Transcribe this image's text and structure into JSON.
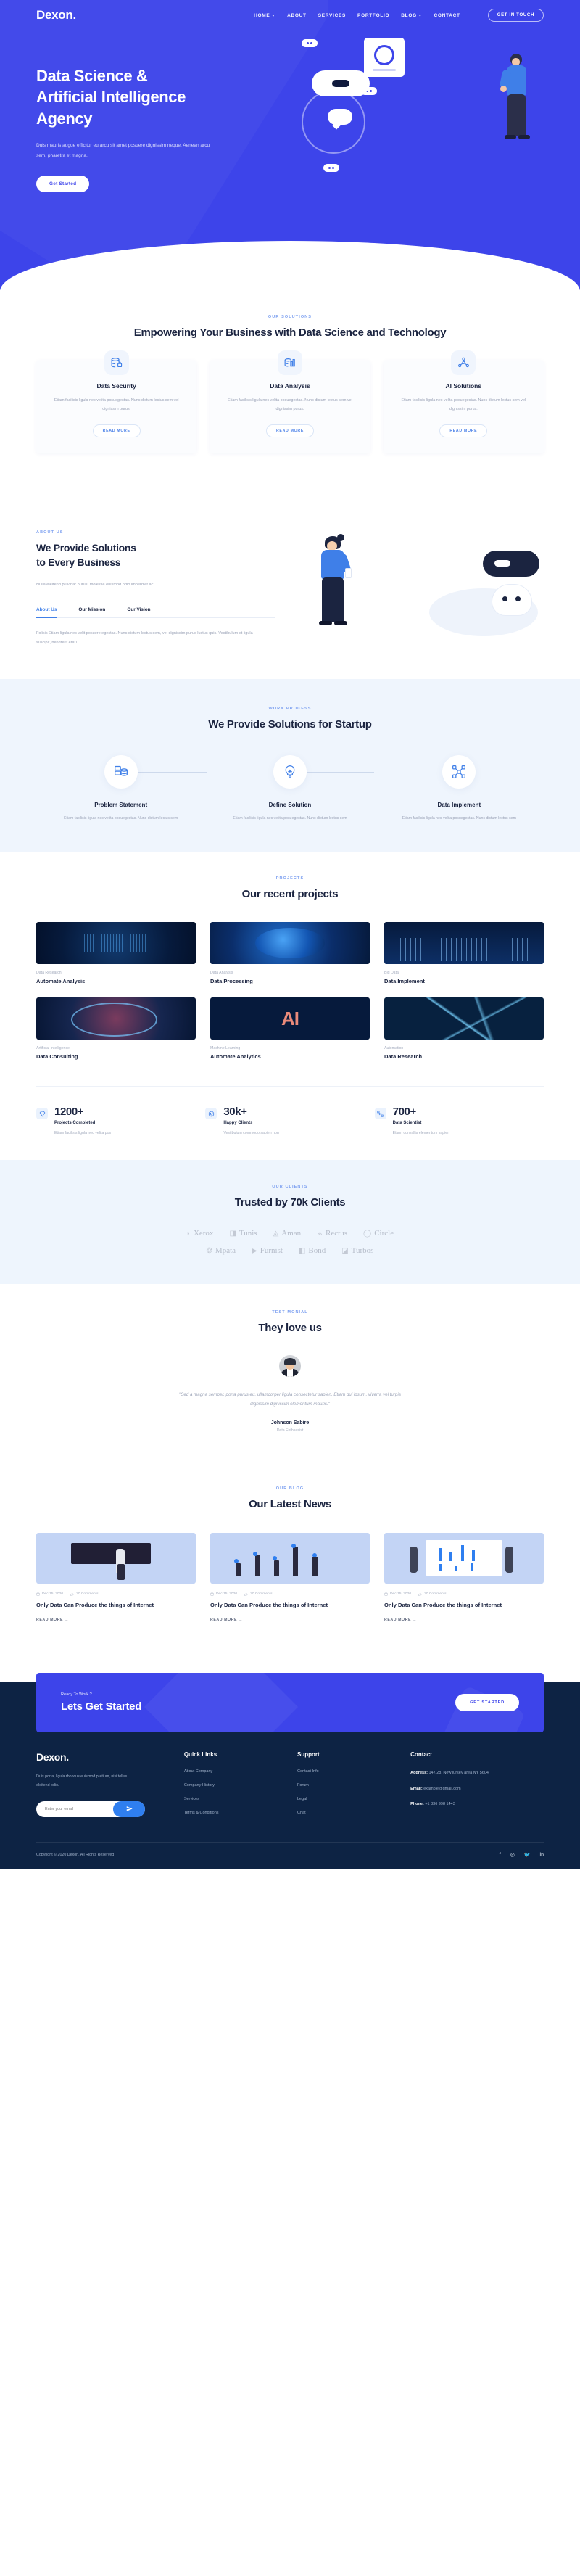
{
  "brand": {
    "name": "Dexon.",
    "accent": "#3d44ea",
    "dark": "#0d2344",
    "link_blue": "#2f7ff0"
  },
  "nav": {
    "items": [
      {
        "label": "HOME",
        "has_caret": true
      },
      {
        "label": "ABOUT",
        "has_caret": false
      },
      {
        "label": "SERVICES",
        "has_caret": false
      },
      {
        "label": "PORTFOLIO",
        "has_caret": false
      },
      {
        "label": "BLOG",
        "has_caret": true
      },
      {
        "label": "CONTACT",
        "has_caret": false
      }
    ],
    "cta": "GET IN TOUCH"
  },
  "hero": {
    "title_lines": [
      "Data Science &",
      "Artificial Intelligence",
      "Agency"
    ],
    "paragraph": "Duis mauris augue efficitur eu arcu sit amet posuere dignissim neque. Aenean arcu sem, pharetra et magna.",
    "button": "Get Started"
  },
  "solutions": {
    "eyebrow": "OUR SOLUTIONS",
    "title": "Empowering Your Business with Data Science and Technology",
    "cards": [
      {
        "icon": "database-lock-icon",
        "title": "Data Security",
        "text": "Etiam facilisis ligula nec velita posuegestas. Nunc dictum lectus sem vel dignissim purus.",
        "button": "READ MORE"
      },
      {
        "icon": "data-analysis-icon",
        "title": "Data Analysis",
        "text": "Etiam facilisis ligula nec velita posuegestas. Nunc dictum lectus sem vel dignissim purus.",
        "button": "READ MORE"
      },
      {
        "icon": "ai-network-icon",
        "title": "AI Solutions",
        "text": "Etiam facilisis ligula nec velita posuegestas. Nunc dictum lectus sem vel dignissim purus.",
        "button": "READ MORE"
      }
    ]
  },
  "about": {
    "eyebrow": "ABOUT US",
    "title_lines": [
      "We Provide Solutions",
      "to Every Business"
    ],
    "lead": "Nulla eleifend pulvinar purus, molestie euismod odio imperdiet ac.",
    "tabs": [
      {
        "label": "About Us",
        "active": true
      },
      {
        "label": "Our Mission",
        "active": false
      },
      {
        "label": "Our Vision",
        "active": false
      }
    ],
    "tab_body": "Folisis Etiam ligula nec velit posuere egestas. Nunc dictum lectus sem, vel dignissim purus luctus quis. Vestibulum et ligula suscipit, hendrerit erat1."
  },
  "process": {
    "eyebrow": "WORK PROCESS",
    "title": "We Provide Solutions for Startup",
    "steps": [
      {
        "icon": "database-stack-icon",
        "title": "Problem Statement",
        "text": "Etiam facilisis ligula nec velita posuegestas. Nunc dictum lectus sem"
      },
      {
        "icon": "lightbulb-icon",
        "title": "Define Solution",
        "text": "Etiam facilisis ligula nec velita posuegestas. Nunc dictum lectus sem"
      },
      {
        "icon": "network-nodes-icon",
        "title": "Data Implement",
        "text": "Etiam facilisis ligula nec velita posuegestas. Nunc dictum lectus sem"
      }
    ]
  },
  "projects": {
    "eyebrow": "PROJECTS",
    "title": "Our recent projects",
    "items": [
      {
        "thumb": "t1",
        "category": "Data Research",
        "name": "Automate Analysis"
      },
      {
        "thumb": "t2",
        "category": "Data Analysis",
        "name": "Data Processing"
      },
      {
        "thumb": "t3",
        "category": "Big Data",
        "name": "Data Implement"
      },
      {
        "thumb": "t4",
        "category": "Artificial Intelligence",
        "name": "Data Consulting"
      },
      {
        "thumb": "t5",
        "category": "Machine Learning",
        "name": "Automate Analytics"
      },
      {
        "thumb": "t6",
        "category": "Automation",
        "name": "Data Research"
      }
    ]
  },
  "stats": [
    {
      "icon": "diamond-icon",
      "number": "1200+",
      "label": "Projects Completed",
      "sub": "Etiam facilisis ligula nec velita pos"
    },
    {
      "icon": "smile-icon",
      "number": "30k+",
      "label": "Happy Clients",
      "sub": "Vestibulum commodo sapien non"
    },
    {
      "icon": "nodes-icon",
      "number": "700+",
      "label": "Data Scientist",
      "sub": "Etiam convallis elementum sapien"
    }
  ],
  "clients": {
    "eyebrow": "OUR CLIENTS",
    "title": "Trusted by 70k Clients",
    "row1": [
      "Xerox",
      "Tunis",
      "Aman",
      "Rectus",
      "Circle"
    ],
    "row2": [
      "Mpata",
      "Furnist",
      "Bond",
      "Turbos"
    ]
  },
  "testimonial": {
    "eyebrow": "TESTIMONIAL",
    "title": "They love us",
    "quote": "\"Sed a magna semper, porta purus eu, ullamcorper ligula consectetur sapien. Etiam dui ipsum, viverra vel turpis dignissim dignissim elementum mauris.\"",
    "name": "Johnson Sabire",
    "role": "Data Enthausist"
  },
  "news": {
    "eyebrow": "OUR BLOG",
    "title": "Our Latest News",
    "posts": [
      {
        "date": "Dec 15, 2020",
        "comments": "20 Comments",
        "title": "Only Data Can Produce the things of Internet",
        "more": "READ MORE"
      },
      {
        "date": "Dec 15, 2020",
        "comments": "20 Comments",
        "title": "Only Data Can Produce the things of Internet",
        "more": "READ MORE"
      },
      {
        "date": "Dec 15, 2020",
        "comments": "20 Comments",
        "title": "Only Data Can Produce the things of Internet",
        "more": "READ MORE"
      }
    ]
  },
  "cta": {
    "sub": "Ready To Work ?",
    "title": "Lets Get Started",
    "button": "GET STARTED"
  },
  "footer": {
    "logo": "Dexon.",
    "about": "Duis porta, ligula rhoncus euismod pretium, nisi tellus eleifend odio.",
    "email_placeholder": "Enter your email",
    "quick_links": {
      "heading": "Quick Links",
      "items": [
        "About Company",
        "Company History",
        "Services",
        "Terms & Conditions"
      ]
    },
    "support": {
      "heading": "Support",
      "items": [
        "Contact Info",
        "Forum",
        "Legal",
        "Chat"
      ]
    },
    "contact": {
      "heading": "Contact",
      "address_label": "Address:",
      "address_value": "147/28, New jursey area NY 5604",
      "email_label": "Email:",
      "email_value": "example@gmail.com",
      "phone_label": "Phone:",
      "phone_value": "+1 336 998 1443"
    },
    "copyright": "Copyright © 2020 Dexon. All Rights Reserved",
    "socials": [
      "facebook-icon",
      "instagram-icon",
      "twitter-icon",
      "linkedin-icon"
    ]
  }
}
